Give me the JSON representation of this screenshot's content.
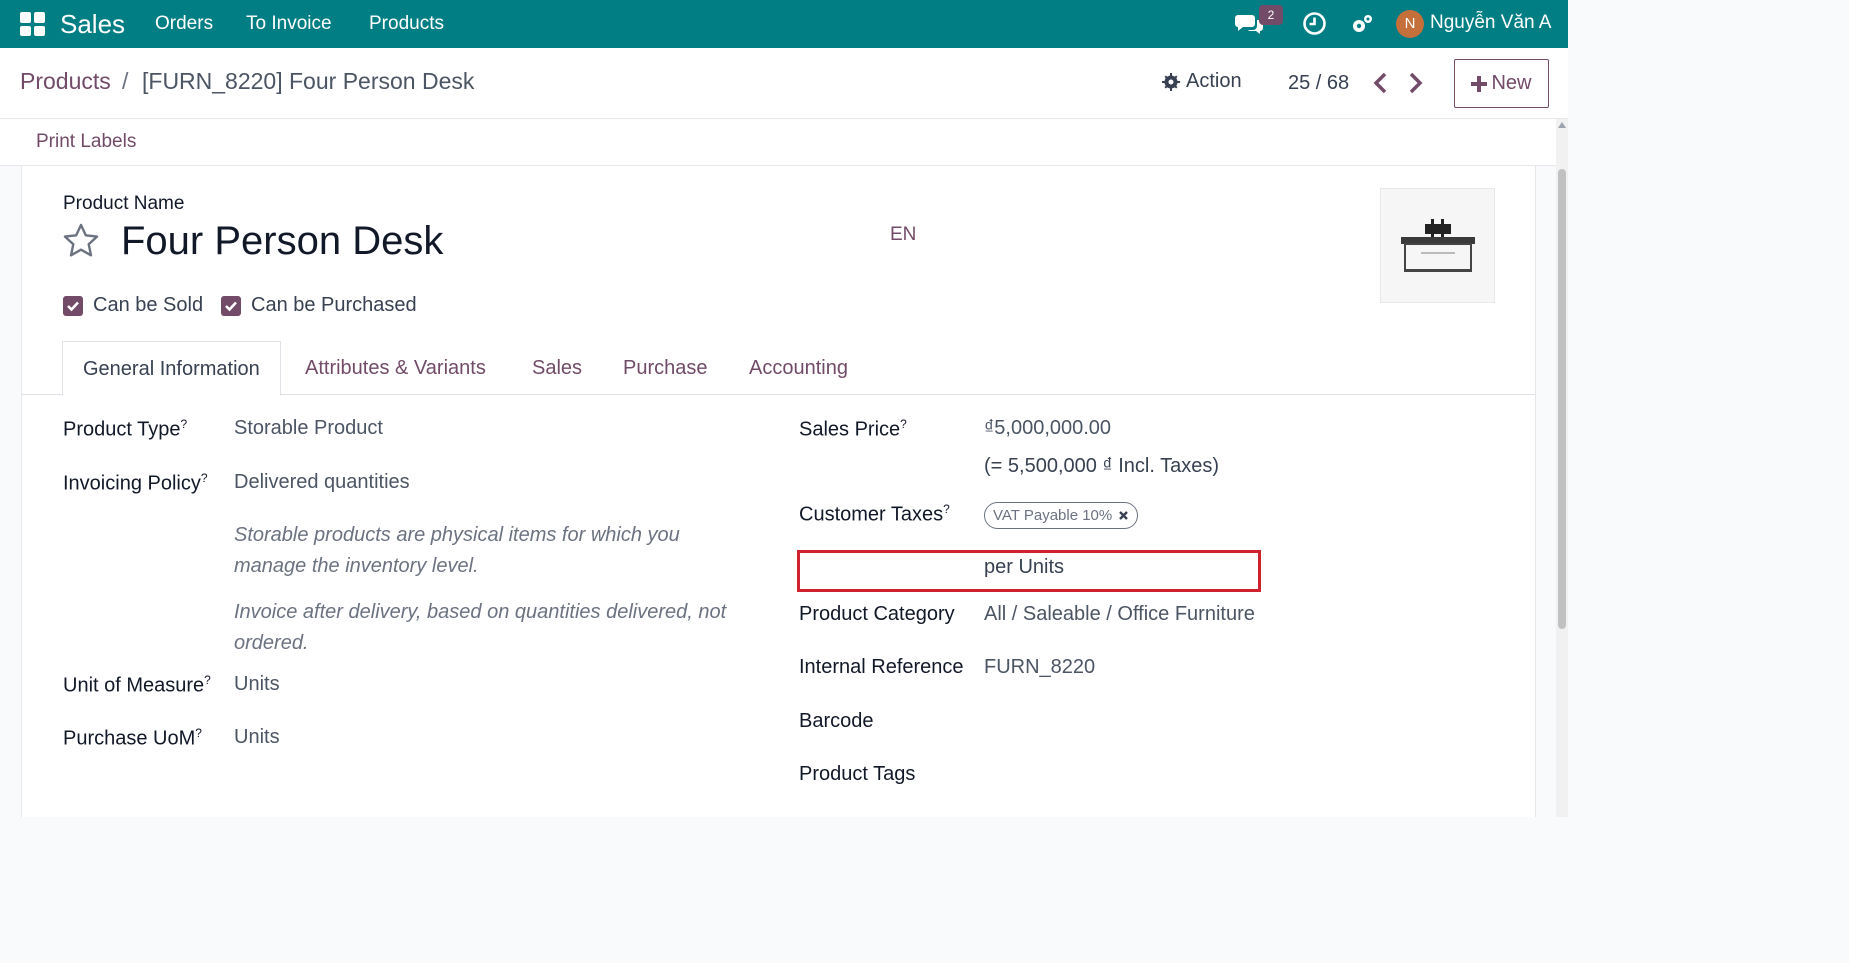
{
  "topbar": {
    "app": "Sales",
    "menu": [
      "Orders",
      "To Invoice",
      "Products"
    ],
    "chat_count": "2",
    "user_initial": "N",
    "user_name": "Nguyễn Văn A",
    "color": "#017e84"
  },
  "breadcrumb": {
    "root": "Products",
    "sep": "/",
    "current": "[FURN_8220] Four Person Desk"
  },
  "control": {
    "action": "Action",
    "pager": "25 / 68",
    "new": "New"
  },
  "status": {
    "print_labels": "Print Labels"
  },
  "product": {
    "name_label": "Product Name",
    "name": "Four Person Desk",
    "lang": "EN",
    "can_be_sold": "Can be Sold",
    "can_be_purchased": "Can be Purchased"
  },
  "tabs": [
    "General Information",
    "Attributes & Variants",
    "Sales",
    "Purchase",
    "Accounting"
  ],
  "general": {
    "product_type_label": "Product Type",
    "product_type": "Storable Product",
    "invoicing_policy_label": "Invoicing Policy",
    "invoicing_policy": "Delivered quantities",
    "help1": "Storable products are physical items for which you manage the inventory level.",
    "help2": "Invoice after delivery, based on quantities delivered, not ordered.",
    "uom_label": "Unit of Measure",
    "uom": "Units",
    "purchase_uom_label": "Purchase UoM",
    "purchase_uom": "Units",
    "sales_price_label": "Sales Price",
    "sales_price": "₫5,000,000.00",
    "incl_taxes": "(= 5,500,000 ₫ Incl. Taxes)",
    "customer_taxes_label": "Customer Taxes",
    "customer_tax_tag": "VAT Payable 10%",
    "per_units": "per Units",
    "category_label": "Product Category",
    "category": "All / Saleable / Office Furniture",
    "internal_ref_label": "Internal Reference",
    "internal_ref": "FURN_8220",
    "barcode_label": "Barcode",
    "tags_label": "Product Tags"
  },
  "accent": "#714b67"
}
